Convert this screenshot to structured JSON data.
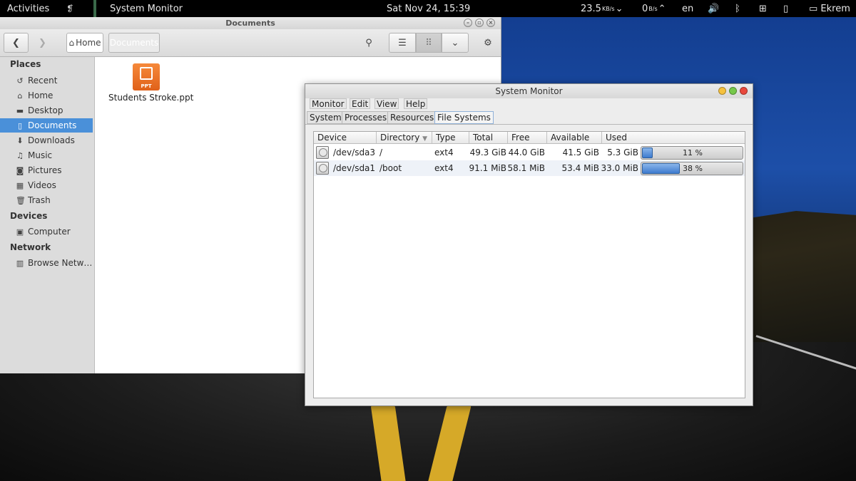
{
  "topbar": {
    "activities": "Activities",
    "app_name": "System Monitor",
    "clock": "Sat Nov 24, 15:39",
    "net_down_value": "23.5",
    "net_down_unit": "KB/s",
    "net_up_value": "0",
    "net_up_unit": "B/s",
    "language": "en",
    "user": "Ekrem"
  },
  "files_window": {
    "title": "Documents",
    "breadcrumb_home": "Home",
    "breadcrumb_current": "Documents",
    "sidebar": {
      "places_header": "Places",
      "places": [
        {
          "label": "Recent",
          "icon": "recent-icon"
        },
        {
          "label": "Home",
          "icon": "home-icon"
        },
        {
          "label": "Desktop",
          "icon": "folder-icon"
        },
        {
          "label": "Documents",
          "icon": "document-icon"
        },
        {
          "label": "Downloads",
          "icon": "download-icon"
        },
        {
          "label": "Music",
          "icon": "music-icon"
        },
        {
          "label": "Pictures",
          "icon": "camera-icon"
        },
        {
          "label": "Videos",
          "icon": "film-icon"
        },
        {
          "label": "Trash",
          "icon": "trash-icon"
        }
      ],
      "devices_header": "Devices",
      "devices": [
        {
          "label": "Computer",
          "icon": "computer-icon"
        }
      ],
      "network_header": "Network",
      "network": [
        {
          "label": "Browse Netw…",
          "icon": "network-icon"
        }
      ]
    },
    "files": [
      {
        "name": "Students Stroke.ppt",
        "badge": "PPT"
      }
    ]
  },
  "sysmon_window": {
    "title": "System Monitor",
    "menus": [
      "Monitor",
      "Edit",
      "View",
      "Help"
    ],
    "tabs": [
      "System",
      "Processes",
      "Resources",
      "File Systems"
    ],
    "selected_tab": "File Systems",
    "columns": [
      "Device",
      "Directory",
      "Type",
      "Total",
      "Free",
      "Available",
      "Used"
    ],
    "rows": [
      {
        "device": "/dev/sda3",
        "directory": "/",
        "type": "ext4",
        "total": "49.3 GiB",
        "free": "44.0 GiB",
        "available": "41.5 GiB",
        "used": "5.3 GiB",
        "used_percent": 11,
        "used_percent_label": "11 %"
      },
      {
        "device": "/dev/sda1",
        "directory": "/boot",
        "type": "ext4",
        "total": "91.1 MiB",
        "free": "58.1 MiB",
        "available": "53.4 MiB",
        "used": "33.0 MiB",
        "used_percent": 38,
        "used_percent_label": "38 %"
      }
    ]
  }
}
